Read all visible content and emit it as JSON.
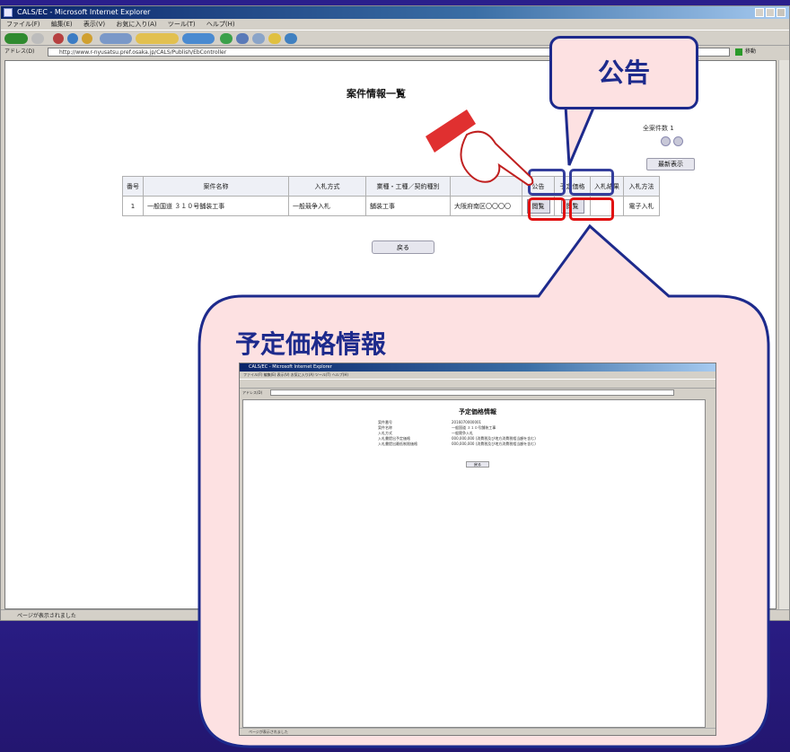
{
  "ie_window": {
    "title": "CALS/EC - Microsoft Internet Explorer",
    "menu": [
      "ファイル(F)",
      "編集(E)",
      "表示(V)",
      "お気に入り(A)",
      "ツール(T)",
      "ヘルプ(H)"
    ],
    "address_label": "アドレス(D)",
    "address_url": "http://www.r-nyusatsu.pref.osaka.jp/CALS/Publish/EbController",
    "go_label": "移動",
    "status_text": "ページが表示されました"
  },
  "page": {
    "title": "案件情報一覧",
    "count_label": "全案件数 1",
    "refresh_button": "最新表示",
    "back_button": "戻る",
    "table": {
      "headers": [
        "番号",
        "案件名称",
        "入札方式",
        "業種・工種／契約種別",
        "",
        "公告",
        "予定価格",
        "入札結果",
        "入札方法"
      ],
      "rows": [
        [
          "1",
          "一般国道 ３１０号舗装工事",
          "一般競争入札",
          "舗装工事",
          "大阪府南区〇〇〇〇",
          "閲覧",
          "閲覧",
          "",
          "電子入札"
        ]
      ]
    }
  },
  "callouts": {
    "koukoku": "公告",
    "yotei": "予定価格情報"
  },
  "inner_screenshot": {
    "page_title": "予定価格情報",
    "rows": [
      [
        "案件番号",
        "2016070000001"
      ],
      [
        "案件名称",
        "一般国道 ３１０号舗装工事"
      ],
      [
        "入札方式",
        "一般競争入札"
      ],
      [
        "入札書提出予定価格",
        "000,000,000 (消費税及び地方消費税相当額を含む)"
      ],
      [
        "入札書提出最低制限価格",
        "000,000,000 (消費税及び地方消費税相当額を含む)"
      ]
    ],
    "back_button": "戻る",
    "status_text": "ページが表示されました"
  },
  "colors": {
    "background": "#2a1f8c",
    "callout_fill": "#fde1e2",
    "callout_border": "#1d2a8c",
    "highlight_blue": "#343e9c",
    "highlight_red": "#e01010"
  }
}
